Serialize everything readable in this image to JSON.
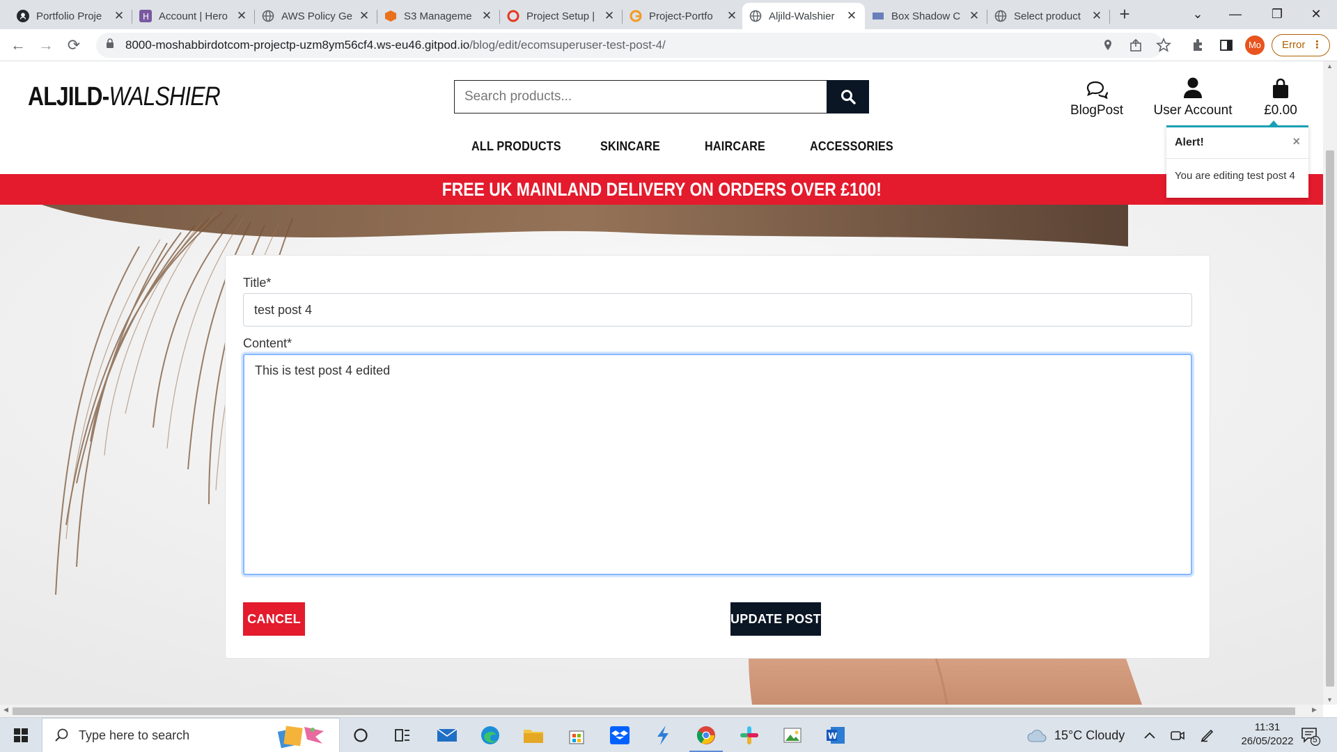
{
  "browser": {
    "tabs": [
      {
        "title": "Portfolio Proje",
        "icon": "github-icon"
      },
      {
        "title": "Account | Hero",
        "icon": "heroku-icon"
      },
      {
        "title": "AWS Policy Ge",
        "icon": "globe-icon"
      },
      {
        "title": "S3 Manageme",
        "icon": "aws-s3-icon"
      },
      {
        "title": "Project Setup |",
        "icon": "opera-icon"
      },
      {
        "title": "Project-Portfo",
        "icon": "g-icon"
      },
      {
        "title": "Aljild-Walshier",
        "icon": "globe-icon",
        "active": true
      },
      {
        "title": "Box Shadow C",
        "icon": "image-icon"
      },
      {
        "title": "Select product",
        "icon": "globe-icon"
      }
    ],
    "url_host": "8000-moshabbirdotcom-projectp-uzm8ym56cf4.ws-eu46.gitpod.io",
    "url_path": "/blog/edit/ecomsuperuser-test-post-4/",
    "profile_initials": "Mo",
    "error_label": "Error"
  },
  "site": {
    "logo_bold": "ALJILD-",
    "logo_italic": "WALSHIER",
    "search_placeholder": "Search products...",
    "header_links": {
      "blog": "BlogPost",
      "account": "User Account",
      "basket": "£0.00"
    },
    "categories": [
      "ALL PRODUCTS",
      "SKINCARE",
      "HAIRCARE",
      "ACCESSORIES"
    ],
    "banner": "FREE UK MAINLAND DELIVERY ON ORDERS OVER £100!",
    "brand_red": "#e31b2d",
    "brand_navy": "#0a1624"
  },
  "toast": {
    "title": "Alert!",
    "message": "You are editing test post 4",
    "close": "×"
  },
  "form": {
    "title_label": "Title*",
    "title_value": "test post 4",
    "content_label": "Content*",
    "content_value": "This is test post 4 edited",
    "cancel_label": "CANCEL",
    "update_label": "UPDATE POST"
  },
  "taskbar": {
    "search_placeholder": "Type here to search",
    "weather": "15°C  Cloudy",
    "time": "11:31",
    "date": "26/05/2022",
    "notifications": "5"
  }
}
